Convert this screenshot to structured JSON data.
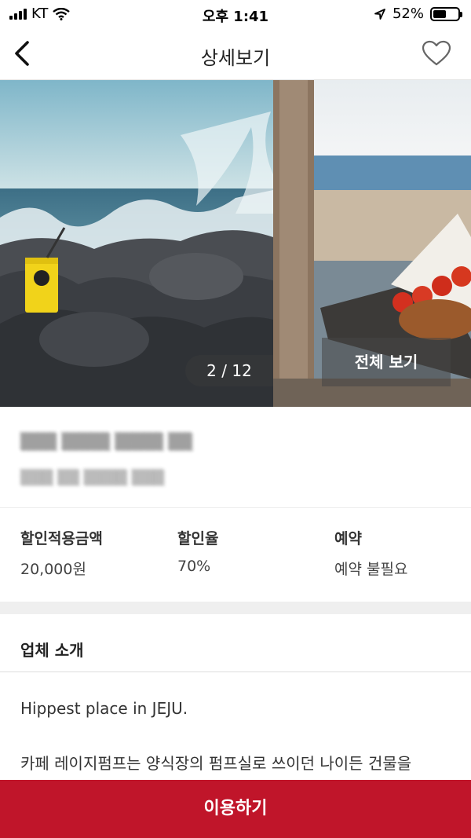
{
  "status_bar": {
    "carrier": "KT",
    "time": "오후 1:41",
    "battery": "52%",
    "battery_level": 0.52
  },
  "nav": {
    "title": "상세보기",
    "back_icon": "chevron-left-icon",
    "like_icon": "heart-outline-icon"
  },
  "gallery": {
    "page_indicator": "2 / 12",
    "view_all_label": "전체 보기"
  },
  "info": {
    "amount_label": "할인적용금액",
    "amount_value": "20,000원",
    "rate_label": "할인율",
    "rate_value": "70%",
    "reservation_label": "예약",
    "reservation_value": "예약 불필요"
  },
  "intro": {
    "section_title": "업체 소개",
    "line1": "Hippest place in JEJU.",
    "line2": "카페 레이지펌프는 양식장의 펌프실로 쓰이던 나이든 건물을"
  },
  "cta": {
    "label": "이용하기"
  },
  "colors": {
    "accent": "#c0152a"
  }
}
